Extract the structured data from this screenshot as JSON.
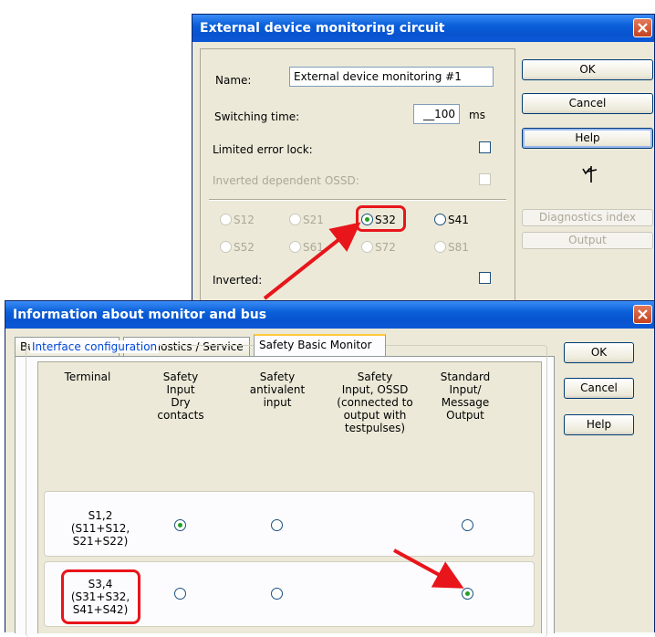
{
  "dialog1": {
    "title": "External device monitoring circuit",
    "name_label": "Name:",
    "name_value": "External device monitoring #1",
    "switching_time_label": "Switching time:",
    "switching_time_value": "__100",
    "switching_time_unit": "ms",
    "limited_error_lock_label": "Limited error lock:",
    "inverted_dependent_ossd_label": "Inverted dependent OSSD:",
    "inverted_label": "Inverted:",
    "radios": [
      {
        "label": "S12",
        "selected": false,
        "enabled": false
      },
      {
        "label": "S21",
        "selected": false,
        "enabled": false
      },
      {
        "label": "S32",
        "selected": true,
        "enabled": true
      },
      {
        "label": "S41",
        "selected": false,
        "enabled": true
      },
      {
        "label": "S52",
        "selected": false,
        "enabled": false
      },
      {
        "label": "S61",
        "selected": false,
        "enabled": false
      },
      {
        "label": "S72",
        "selected": false,
        "enabled": false
      },
      {
        "label": "S81",
        "selected": false,
        "enabled": false
      }
    ],
    "buttons": {
      "ok": "OK",
      "cancel": "Cancel",
      "help": "Help",
      "diagnostics_index": "Diagnostics index",
      "output": "Output"
    }
  },
  "dialog2": {
    "title": "Information about monitor and bus",
    "tabs": [
      "Bus information",
      "Diagnostics / Service",
      "Safety Basic Monitor"
    ],
    "group_title": "Interface configuration",
    "columns": {
      "terminal": "Terminal",
      "dry": [
        "Safety",
        "Input",
        "Dry",
        "contacts"
      ],
      "antivalent": [
        "Safety",
        "antivalent",
        "input"
      ],
      "ossd": [
        "Safety",
        "Input, OSSD",
        "(connected to",
        "output with",
        "testpulses)"
      ],
      "standard": [
        "Standard",
        "Input/",
        "Message",
        "Output"
      ]
    },
    "rows": [
      {
        "label": [
          "S1,2",
          "(S11+S12,",
          "S21+S22)"
        ],
        "dry": true,
        "antivalent": false,
        "standard": false
      },
      {
        "label": [
          "S3,4",
          "(S31+S32,",
          "S41+S42)"
        ],
        "dry": false,
        "antivalent": false,
        "standard": true
      }
    ],
    "buttons": {
      "ok": "OK",
      "cancel": "Cancel",
      "help": "Help"
    }
  },
  "colors": {
    "titlebar": "#0a5fd9",
    "window_bg": "#ece9d8",
    "highlight": "#e8151b",
    "radio_dot": "#21a121"
  },
  "icons": [
    "close-icon",
    "monitor-circuit-icon",
    "arrow-annotation"
  ]
}
